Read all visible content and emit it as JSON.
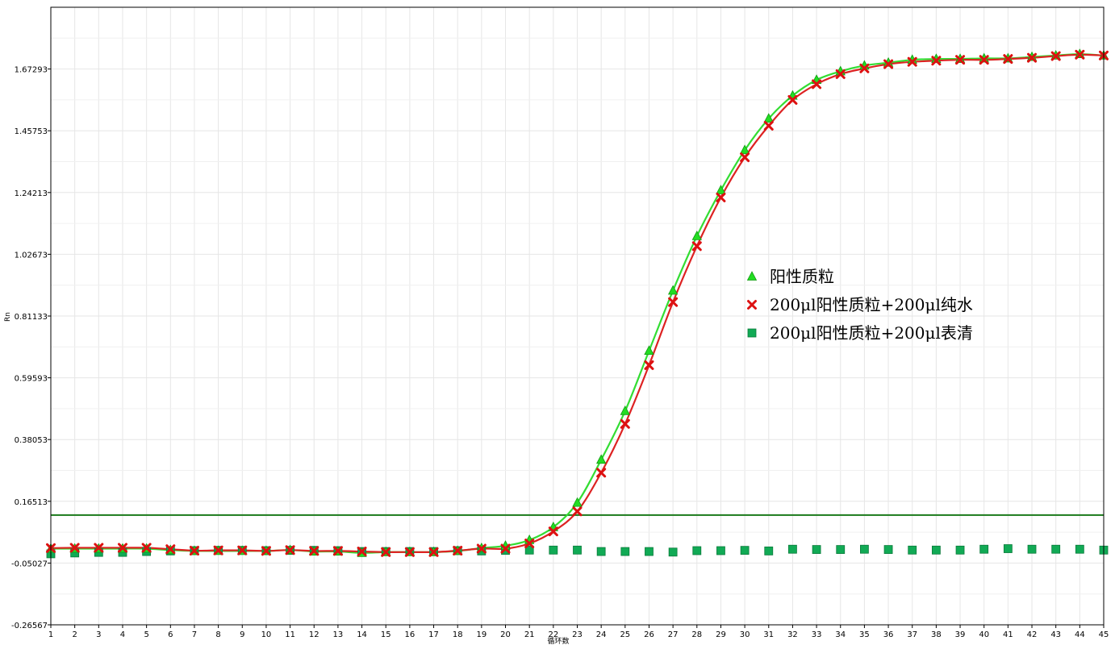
{
  "chart_data": {
    "type": "line",
    "xlabel": "循环数",
    "ylabel": "Rn",
    "xlim": [
      1,
      45
    ],
    "ylim": [
      -0.26567,
      1.88833
    ],
    "y_ticks": [
      "-0.26567",
      "-0.05027",
      "0.16513",
      "0.38053",
      "0.59593",
      "0.81133",
      "1.02673",
      "1.24213",
      "1.45753",
      "1.67293"
    ],
    "x_ticks": [
      "1",
      "2",
      "3",
      "4",
      "5",
      "6",
      "7",
      "8",
      "9",
      "10",
      "11",
      "12",
      "13",
      "14",
      "15",
      "16",
      "17",
      "18",
      "19",
      "20",
      "21",
      "22",
      "23",
      "24",
      "25",
      "26",
      "27",
      "28",
      "29",
      "30",
      "31",
      "32",
      "33",
      "34",
      "35",
      "36",
      "37",
      "38",
      "39",
      "40",
      "41",
      "42",
      "43",
      "44",
      "45"
    ],
    "grid": true,
    "legend_position": "center-right",
    "threshold": 0.117,
    "threshold_color": "#1a7a1a",
    "series": [
      {
        "name": "阳性质粒",
        "marker": "triangle",
        "color": "#33dd33",
        "marker_color": "#22dd22",
        "line": true,
        "x": [
          1,
          2,
          3,
          4,
          5,
          6,
          7,
          8,
          9,
          10,
          11,
          12,
          13,
          14,
          15,
          16,
          17,
          18,
          19,
          20,
          21,
          22,
          23,
          24,
          25,
          26,
          27,
          28,
          29,
          30,
          31,
          32,
          33,
          34,
          35,
          36,
          37,
          38,
          39,
          40,
          41,
          42,
          43,
          44,
          45
        ],
        "values": [
          0.0,
          0.0,
          0.0,
          0.0,
          0.0,
          -0.005,
          -0.008,
          -0.008,
          -0.008,
          -0.008,
          -0.005,
          -0.01,
          -0.01,
          -0.015,
          -0.012,
          -0.012,
          -0.012,
          -0.008,
          0.002,
          0.01,
          0.03,
          0.075,
          0.16,
          0.31,
          0.48,
          0.69,
          0.9,
          1.09,
          1.25,
          1.39,
          1.5,
          1.58,
          1.635,
          1.665,
          1.685,
          1.695,
          1.705,
          1.708,
          1.708,
          1.71,
          1.71,
          1.715,
          1.72,
          1.725,
          1.72
        ]
      },
      {
        "name": "200μl阳性质粒+200μl纯水",
        "marker": "x",
        "color": "#dd2222",
        "marker_color": "#dd1111",
        "line": true,
        "x": [
          1,
          2,
          3,
          4,
          5,
          6,
          7,
          8,
          9,
          10,
          11,
          12,
          13,
          14,
          15,
          16,
          17,
          18,
          19,
          20,
          21,
          22,
          23,
          24,
          25,
          26,
          27,
          28,
          29,
          30,
          31,
          32,
          33,
          34,
          35,
          36,
          37,
          38,
          39,
          40,
          41,
          42,
          43,
          44,
          45
        ],
        "values": [
          0.002,
          0.003,
          0.003,
          0.003,
          0.003,
          -0.002,
          -0.007,
          -0.006,
          -0.006,
          -0.008,
          -0.005,
          -0.008,
          -0.008,
          -0.01,
          -0.012,
          -0.012,
          -0.012,
          -0.007,
          0.0,
          0.0,
          0.018,
          0.06,
          0.13,
          0.265,
          0.435,
          0.64,
          0.86,
          1.055,
          1.225,
          1.365,
          1.475,
          1.565,
          1.62,
          1.655,
          1.675,
          1.69,
          1.698,
          1.702,
          1.705,
          1.705,
          1.708,
          1.712,
          1.718,
          1.723,
          1.72
        ]
      },
      {
        "name": "200μl阳性质粒+200μl表清",
        "marker": "square",
        "color": "#119944",
        "marker_color": "#11aa55",
        "line": false,
        "x": [
          1,
          2,
          3,
          4,
          5,
          6,
          7,
          8,
          9,
          10,
          11,
          12,
          13,
          14,
          15,
          16,
          17,
          18,
          19,
          20,
          21,
          22,
          23,
          24,
          25,
          26,
          27,
          28,
          29,
          30,
          31,
          32,
          33,
          34,
          35,
          36,
          37,
          38,
          39,
          40,
          41,
          42,
          43,
          44,
          45
        ],
        "values": [
          -0.018,
          -0.015,
          -0.013,
          -0.013,
          -0.01,
          -0.008,
          -0.007,
          -0.006,
          -0.006,
          -0.007,
          -0.006,
          -0.006,
          -0.007,
          -0.01,
          -0.01,
          -0.01,
          -0.01,
          -0.007,
          -0.008,
          -0.006,
          -0.005,
          -0.005,
          -0.005,
          -0.01,
          -0.01,
          -0.01,
          -0.012,
          -0.007,
          -0.007,
          -0.006,
          -0.008,
          -0.002,
          -0.003,
          -0.003,
          -0.002,
          -0.003,
          -0.005,
          -0.005,
          -0.005,
          -0.002,
          0.0,
          -0.002,
          -0.002,
          -0.002,
          -0.005
        ]
      }
    ]
  }
}
